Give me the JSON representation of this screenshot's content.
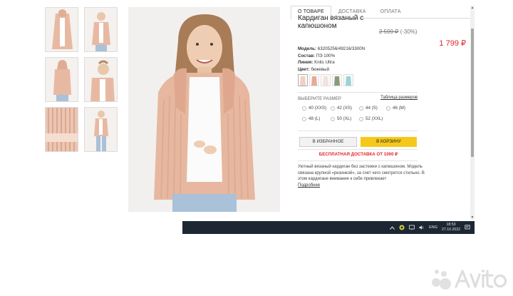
{
  "tabs": [
    {
      "label": "О ТОВАРЕ",
      "active": true
    },
    {
      "label": "ДОСТАВКА",
      "active": false
    },
    {
      "label": "ОПЛАТА",
      "active": false
    }
  ],
  "product": {
    "title": "Кардиган вязаный с капюшоном",
    "old_price": "2 599 ₽",
    "discount": "(-30%)",
    "new_price": "1 799 ₽",
    "model_label": "Модель:",
    "model_value": "63205256/49216/3300N",
    "composition_label": "Состав:",
    "composition_value": "ПЭ 100%",
    "line_label": "Линия:",
    "line_value": "Knits Ultra",
    "color_label": "Цвет:",
    "color_value": "бежевый"
  },
  "swatch_colors": [
    "#f1d0c4",
    "#e6a99a",
    "#f3e3dc",
    "#8b9a7b",
    "#9dd3d6"
  ],
  "sizes_section": {
    "heading": "ВЫБЕРИТЕ РАЗМЕР",
    "chart_link": "Таблица размеров",
    "options": [
      "40 (XXS)",
      "42 (XS)",
      "44 (S)",
      "46 (M)",
      "48 (L)",
      "50 (XL)",
      "52 (XXL)"
    ]
  },
  "buttons": {
    "favorite": "В ИЗБРАННОЕ",
    "cart": "В КОРЗИНУ"
  },
  "free_shipping": "БЕСПЛАТНАЯ ДОСТАВКА ОТ 1000 ₽",
  "description": "Уютный вязаный кардиган без застежки с капюшоном. Модель связана крупной «резинкой», за счет чего смотрится стильно. В этом кардигане внимание к себе привлекает",
  "more_link": "Подробнее",
  "taskbar": {
    "language": "ENG",
    "time": "18:53",
    "date": "27.10.2022"
  },
  "colors": {
    "accent_red": "#e2242a",
    "cart_yellow": "#f6c81b",
    "taskbar": "#1c2733"
  }
}
